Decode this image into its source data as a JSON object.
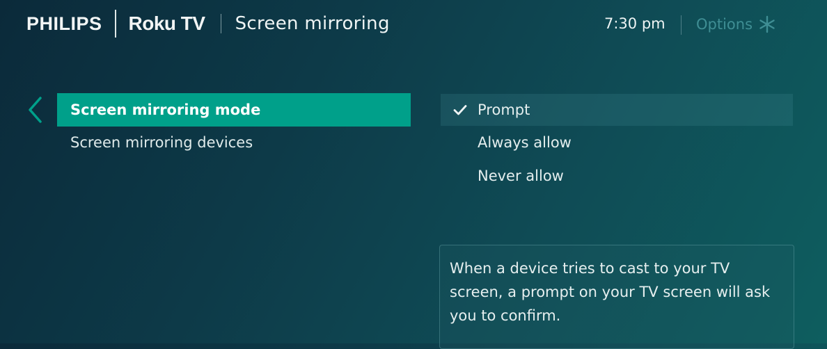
{
  "header": {
    "brand_primary": "PHILIPS",
    "brand_secondary": "Roku TV",
    "title": "Screen mirroring",
    "time": "7:30 pm",
    "options_label": "Options",
    "options_icon": "asterisk-icon"
  },
  "menu": {
    "items": [
      {
        "label": "Screen mirroring mode",
        "selected": true
      },
      {
        "label": "Screen mirroring devices",
        "selected": false
      }
    ]
  },
  "choices": {
    "items": [
      {
        "label": "Prompt",
        "checked": true
      },
      {
        "label": "Always allow",
        "checked": false
      },
      {
        "label": "Never allow",
        "checked": false
      }
    ]
  },
  "description": {
    "text": "When a device tries to cast to your TV screen, a prompt on your TV screen will ask you to confirm."
  },
  "colors": {
    "accent": "#00a08a",
    "options_dim": "#3f8e94",
    "background_dark": "#0b2a3a",
    "background_light": "#0e5e5f"
  }
}
